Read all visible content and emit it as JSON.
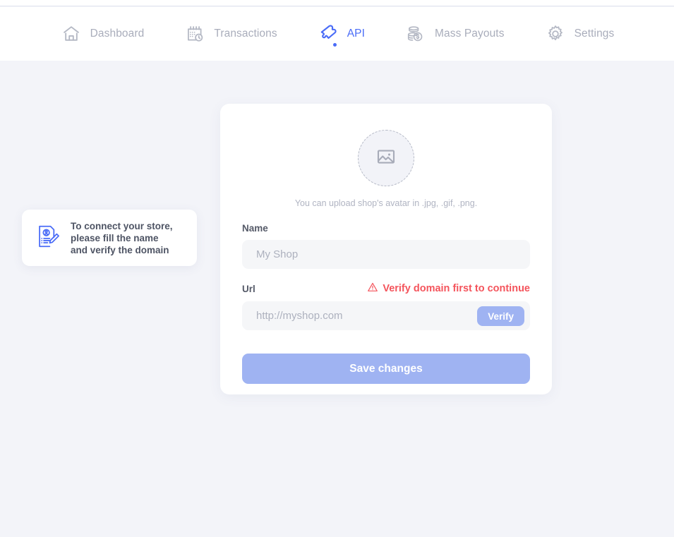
{
  "theme": {
    "page_bg": "#f3f4f9",
    "card_bg": "#ffffff",
    "accent_blue": "#4a6cf7",
    "button_blue": "#9fb3f2",
    "error_red": "#f4545c",
    "muted_text": "#a9adbb",
    "input_bg": "#f5f6f8"
  },
  "navbar": {
    "items": [
      {
        "label": "Dashboard",
        "icon": "home-icon",
        "active": false
      },
      {
        "label": "Transactions",
        "icon": "calendar-clock-icon",
        "active": false
      },
      {
        "label": "API",
        "icon": "puzzle-piece-icon",
        "active": true
      },
      {
        "label": "Mass Payouts",
        "icon": "coins-dollar-icon",
        "active": false
      },
      {
        "label": "Settings",
        "icon": "gear-icon",
        "active": false
      }
    ]
  },
  "hint": {
    "icon": "document-edit-icon",
    "text": "To connect your store,\nplease fill the name\nand verify the domain"
  },
  "shop_form": {
    "avatar": {
      "icon": "image-placeholder-icon",
      "hint": "You can upload shop's avatar in .jpg, .gif, .png."
    },
    "name_field": {
      "label": "Name",
      "placeholder": "My Shop",
      "value": ""
    },
    "url_field": {
      "label": "Url",
      "placeholder": "http://myshop.com",
      "value": "",
      "error": "Verify domain first to continue",
      "error_icon": "warning-triangle-icon",
      "verify_label": "Verify"
    },
    "save_label": "Save changes"
  }
}
